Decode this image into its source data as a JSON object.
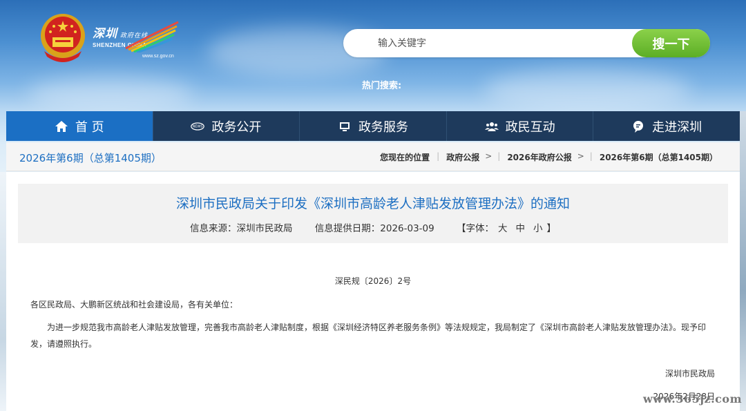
{
  "header": {
    "logo_cn": "深圳",
    "logo_cn_small": "政府在线",
    "logo_en": "SHENZHEN CHINA",
    "logo_url": "www.sz.gov.cn",
    "search_placeholder": "输入关键字",
    "search_button": "搜一下",
    "hot_search_label": "热门搜索:"
  },
  "nav": {
    "items": [
      {
        "label": "首 页",
        "icon": "home-icon"
      },
      {
        "label": "政务公开",
        "icon": "news-icon"
      },
      {
        "label": "政务服务",
        "icon": "monitor-icon"
      },
      {
        "label": "政民互动",
        "icon": "people-icon"
      },
      {
        "label": "走进深圳",
        "icon": "chat-icon"
      }
    ]
  },
  "breadcrumb": {
    "issue": "2026年第6期（总第1405期）",
    "location_label": "您现在的位置",
    "items": [
      "政府公报",
      "2026年政府公报",
      "2026年第6期（总第1405期）"
    ],
    "separator": ">"
  },
  "article": {
    "title": "深圳市民政局关于印发《深圳市高龄老人津贴发放管理办法》的通知",
    "source": "信息来源：深圳市民政局",
    "date": "信息提供日期：2026-03-09",
    "font_label_open": "【字体：",
    "font_large": "大",
    "font_medium": "中",
    "font_small": "小",
    "font_label_close": "】",
    "doc_number": "深民规〔2026〕2号",
    "recipients": "各区民政局、大鹏新区统战和社会建设局，各有关单位：",
    "body": "为进一步规范我市高龄老人津贴发放管理，完善我市高龄老人津贴制度，根据《深圳经济特区养老服务条例》等法规规定，我局制定了《深圳市高龄老人津贴发放管理办法》。现予印发，请遵照执行。",
    "signature": "深圳市民政局",
    "sign_date": "2026年2月28日"
  },
  "watermark": "www.365jz.com",
  "colors": {
    "nav_bg": "#1e3a5c",
    "nav_active": "#1b6fc4",
    "title_blue": "#1d6fc2",
    "search_green": "#5cae25"
  }
}
